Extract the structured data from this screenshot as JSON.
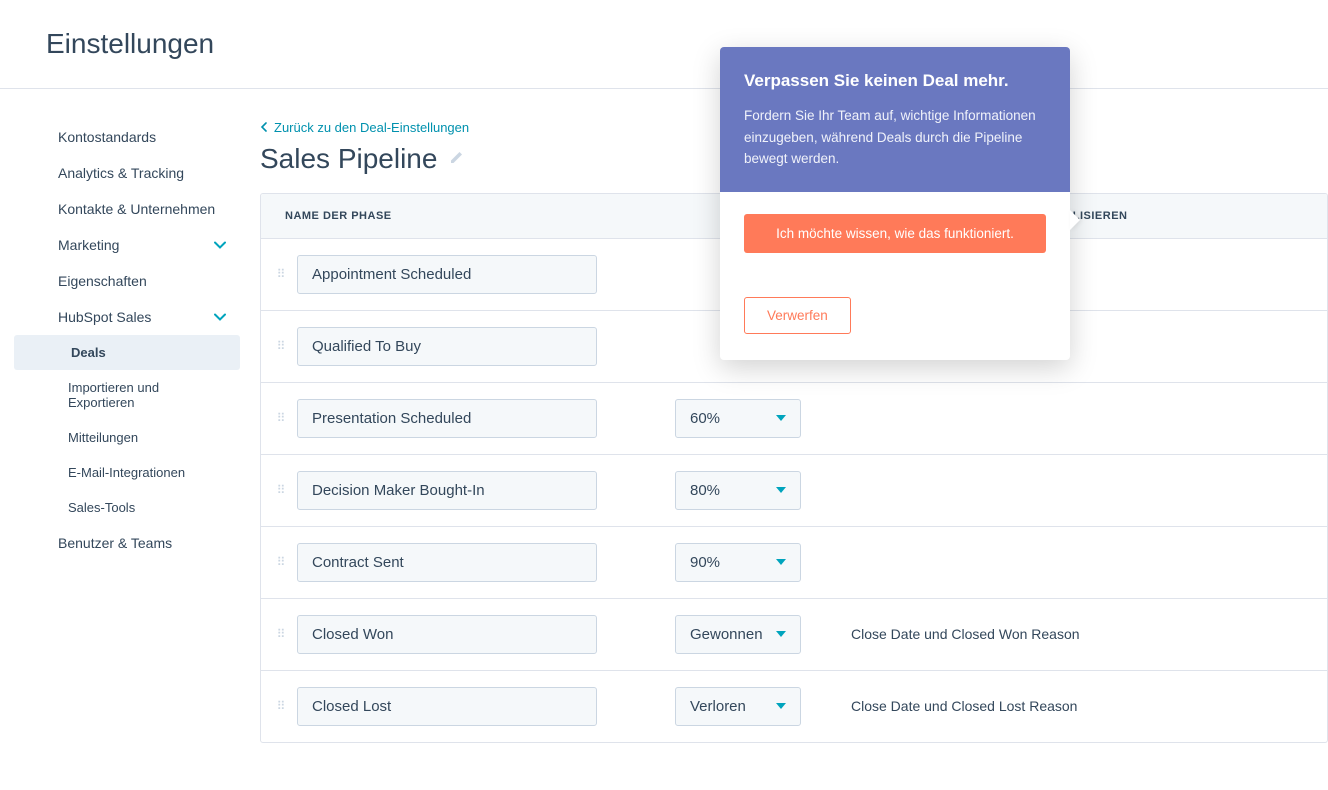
{
  "page_title": "Einstellungen",
  "sidebar": {
    "items": [
      {
        "label": "Kontostandards",
        "expandable": false
      },
      {
        "label": "Analytics & Tracking",
        "expandable": false
      },
      {
        "label": "Kontakte & Unternehmen",
        "expandable": false
      },
      {
        "label": "Marketing",
        "expandable": true
      },
      {
        "label": "Eigenschaften",
        "expandable": false
      },
      {
        "label": "HubSpot Sales",
        "expandable": true
      }
    ],
    "sub_items": [
      {
        "label": "Deals",
        "active": true
      },
      {
        "label": "Importieren und Exportieren"
      },
      {
        "label": "Mitteilungen"
      },
      {
        "label": "E-Mail-Integrationen"
      },
      {
        "label": "Sales-Tools"
      }
    ],
    "last_item": {
      "label": "Benutzer & Teams"
    }
  },
  "main": {
    "back_link": "Zurück zu den Deal-Einstellungen",
    "pipeline_title": "Sales Pipeline",
    "columns": {
      "name": "NAME DER PHASE",
      "props": "PHASEN-EIGENSCHAFTEN AKTUALISIEREN"
    },
    "stages": [
      {
        "name": "Appointment Scheduled",
        "prob": "",
        "props": ""
      },
      {
        "name": "Qualified To Buy",
        "prob": "",
        "props": ""
      },
      {
        "name": "Presentation Scheduled",
        "prob": "60%",
        "props": ""
      },
      {
        "name": "Decision Maker Bought-In",
        "prob": "80%",
        "props": ""
      },
      {
        "name": "Contract Sent",
        "prob": "90%",
        "props": ""
      },
      {
        "name": "Closed Won",
        "prob": "Gewonnen",
        "props": "Close Date und Closed Won Reason"
      },
      {
        "name": "Closed Lost",
        "prob": "Verloren",
        "props": "Close Date und Closed Lost Reason"
      }
    ]
  },
  "popover": {
    "title": "Verpassen Sie keinen Deal mehr.",
    "body": "Fordern Sie Ihr Team auf, wichtige Informationen einzugeben, während Deals durch die Pipeline bewegt werden.",
    "primary_btn": "Ich möchte wissen, wie das funktioniert.",
    "secondary_btn": "Verwerfen"
  }
}
